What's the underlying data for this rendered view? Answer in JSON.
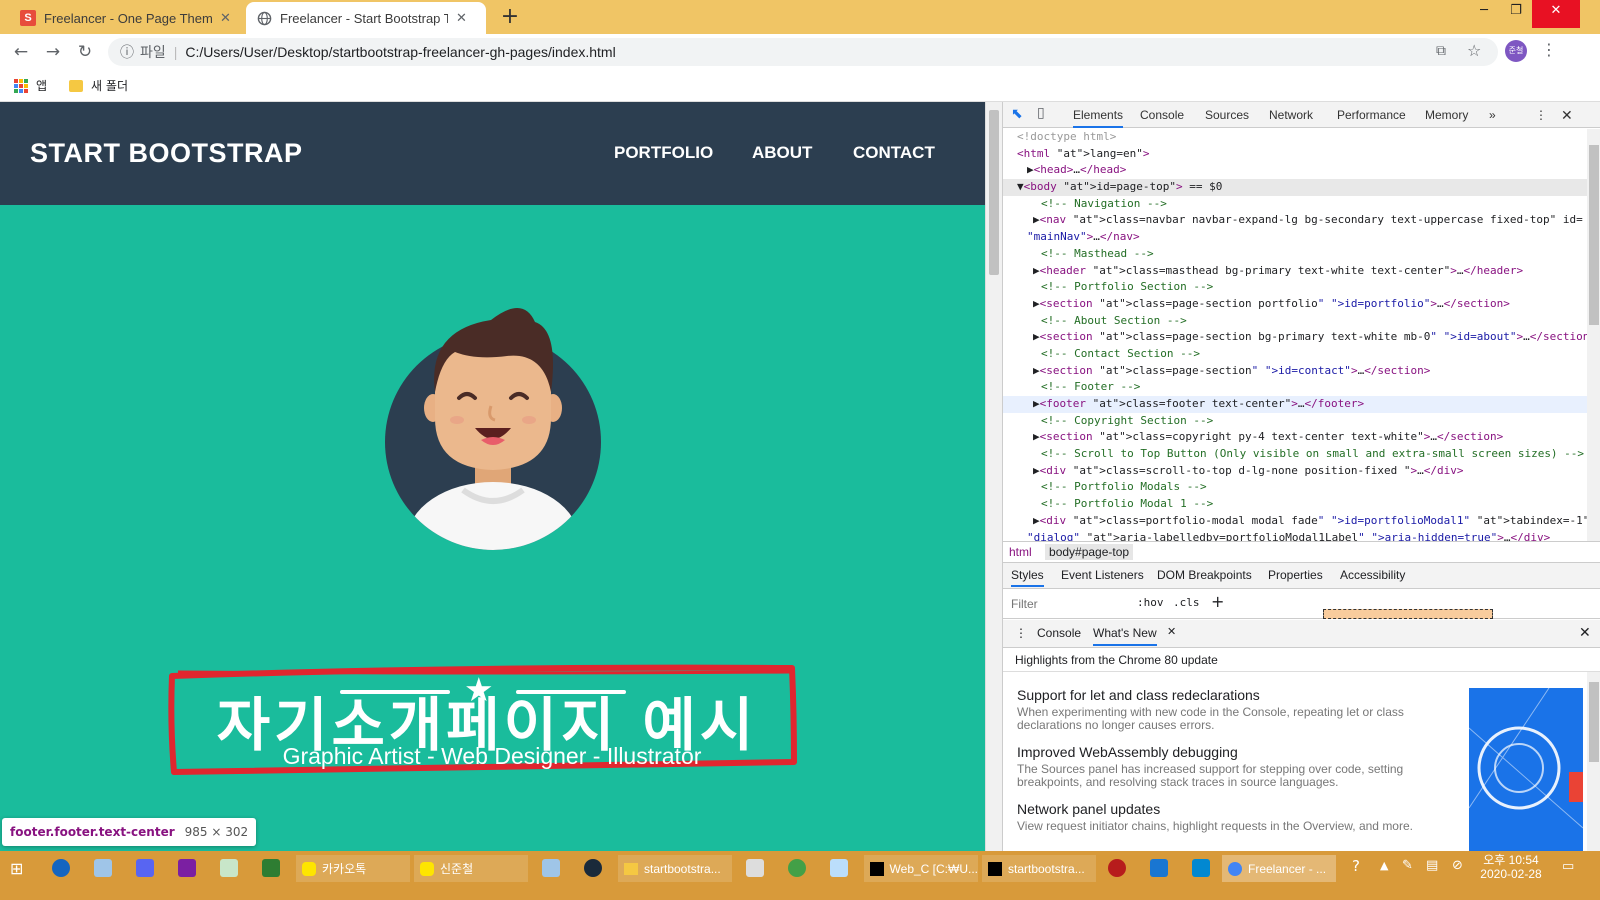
{
  "browser": {
    "tabs": [
      {
        "title": "Freelancer - One Page Theme -",
        "favicon": "S"
      },
      {
        "title": "Freelancer - Start Bootstrap The",
        "favicon": "globe-icon"
      }
    ],
    "window_controls": [
      "─",
      "❐",
      "✕"
    ],
    "address": {
      "scheme": "파일",
      "url": "C:/Users/User/Desktop/startbootstrap-freelancer-gh-pages/index.html"
    },
    "profile": "준철",
    "bookmarks": [
      {
        "label": "앱",
        "icon": "apps-grid-icon"
      },
      {
        "label": "새 폴더",
        "icon": "folder-icon"
      }
    ]
  },
  "page": {
    "brand": "START BOOTSTRAP",
    "nav": [
      "PORTFOLIO",
      "ABOUT",
      "CONTACT"
    ],
    "title": "자기소개페이지 예시",
    "subtitle": "Graphic Artist - Web Designer - Illustrator",
    "tooltip": {
      "selector": "footer.footer.text-center",
      "size": "985 × 302"
    },
    "colors": {
      "navbar": "#2c3e50",
      "primary": "#1abc9c",
      "annotation": "#e0262f"
    }
  },
  "devtools": {
    "tabs": [
      "Elements",
      "Console",
      "Sources",
      "Network",
      "Performance",
      "Memory"
    ],
    "dom": [
      {
        "text": "<!doctype html>",
        "cls": "gr"
      },
      {
        "text": "<html lang=\"en\">"
      },
      {
        "text": "▶<head>…</head>"
      },
      {
        "text": "▼<body id=\"page-top\"> == $0"
      },
      {
        "text": "<!-- Navigation -->"
      },
      {
        "text": "▶<nav class=\"navbar navbar-expand-lg bg-secondary text-uppercase fixed-top\" id="
      },
      {
        "text": "\"mainNav\">…</nav>"
      },
      {
        "text": "<!-- Masthead -->"
      },
      {
        "text": "▶<header class=\"masthead bg-primary text-white text-center\">…</header>"
      },
      {
        "text": "<!-- Portfolio Section -->"
      },
      {
        "text": "▶<section class=\"page-section portfolio\" id=\"portfolio\">…</section>"
      },
      {
        "text": "<!-- About Section -->"
      },
      {
        "text": "▶<section class=\"page-section bg-primary text-white mb-0\" id=\"about\">…</section>"
      },
      {
        "text": "<!-- Contact Section -->"
      },
      {
        "text": "▶<section class=\"page-section\" id=\"contact\">…</section>"
      },
      {
        "text": "<!-- Footer -->"
      },
      {
        "text": "▶<footer class=\"footer text-center\">…</footer>"
      },
      {
        "text": "<!-- Copyright Section -->"
      },
      {
        "text": "▶<section class=\"copyright py-4 text-center text-white\">…</section>"
      },
      {
        "text": "<!-- Scroll to Top Button (Only visible on small and extra-small screen sizes) -->"
      },
      {
        "text": "▶<div class=\"scroll-to-top d-lg-none position-fixed \">…</div>"
      },
      {
        "text": "<!-- Portfolio Modals -->"
      },
      {
        "text": "<!-- Portfolio Modal 1 -->"
      },
      {
        "text": "▶<div class=\"portfolio-modal modal fade\" id=\"portfolioModal1\" tabindex=\"-1\" role="
      },
      {
        "text": "\"dialog\" aria-labelledby=\"portfolioModal1Label\" aria-hidden=\"true\">…</div>"
      }
    ],
    "breadcrumb": [
      "html",
      "body#page-top"
    ],
    "style_tabs": [
      "Styles",
      "Event Listeners",
      "DOM Breakpoints",
      "Properties",
      "Accessibility"
    ],
    "filter_placeholder": "Filter",
    "filter_buttons": [
      ":hov",
      ".cls",
      "+"
    ],
    "drawer_tabs": [
      "Console",
      "What's New"
    ],
    "whats_new_header": "Highlights from the Chrome 80 update",
    "whats_new": [
      {
        "title": "Support for let and class redeclarations",
        "desc": "When experimenting with new code in the Console, repeating let or class declarations no longer causes errors."
      },
      {
        "title": "Improved WebAssembly debugging",
        "desc": "The Sources panel has increased support for stepping over code, setting breakpoints, and resolving stack traces in source languages."
      },
      {
        "title": "Network panel updates",
        "desc": "View request initiator chains, highlight requests in the Overview, and more."
      }
    ]
  },
  "taskbar": {
    "apps": [
      {
        "label": "카카오톡"
      },
      {
        "label": "신준철"
      },
      {
        "label": "startbootstra..."
      },
      {
        "label": "Web_C [C:₩U..."
      },
      {
        "label": "startbootstra..."
      },
      {
        "label": "Freelancer - ..."
      }
    ],
    "clock": {
      "time": "오후 10:54",
      "date": "2020-02-28"
    }
  }
}
